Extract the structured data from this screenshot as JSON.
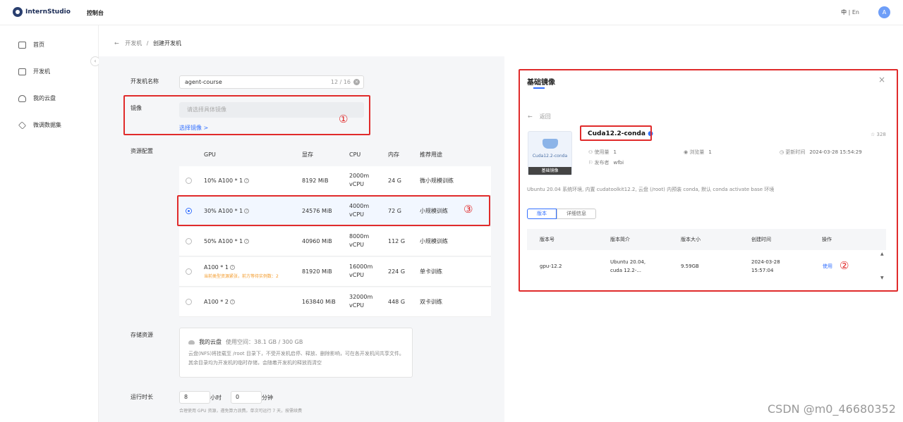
{
  "header": {
    "logo_text": "InternStudio",
    "console_label": "控制台",
    "lang_zh": "中",
    "lang_sep": "|",
    "lang_en": "En",
    "avatar_letter": "A"
  },
  "sidebar": {
    "items": [
      {
        "label": "首页",
        "icon": "home-icon"
      },
      {
        "label": "开发机",
        "icon": "terminal-icon"
      },
      {
        "label": "我的云盘",
        "icon": "cloud-icon"
      },
      {
        "label": "微调数据集",
        "icon": "dataset-icon"
      }
    ]
  },
  "breadcrumb": {
    "parent": "开发机",
    "sep": "/",
    "current": "创建开发机"
  },
  "form": {
    "name_label": "开发机名称",
    "name_value": "agent-course",
    "name_count": "12 / 16",
    "image_label": "镜像",
    "image_placeholder": "请选择具体镜像",
    "select_image_link": "选择镜像 >",
    "resource_label": "资源配置",
    "storage_label": "存储资源",
    "runtime_label": "运行时长"
  },
  "resource_table": {
    "headers": [
      "GPU",
      "显存",
      "CPU",
      "内存",
      "推荐用途"
    ],
    "rows": [
      {
        "gpu": "10% A100 * 1",
        "mem": "8192 MiB",
        "cpu1": "2000m",
        "cpu2": "vCPU",
        "ram": "24 G",
        "usage": "微小规模训练",
        "warn": ""
      },
      {
        "gpu": "30% A100 * 1",
        "mem": "24576 MiB",
        "cpu1": "4000m",
        "cpu2": "vCPU",
        "ram": "72 G",
        "usage": "小规模训练",
        "warn": ""
      },
      {
        "gpu": "50% A100 * 1",
        "mem": "40960 MiB",
        "cpu1": "8000m",
        "cpu2": "vCPU",
        "ram": "112 G",
        "usage": "小规模训练",
        "warn": ""
      },
      {
        "gpu": "A100 * 1",
        "mem": "81920 MiB",
        "cpu1": "16000m",
        "cpu2": "vCPU",
        "ram": "224 G",
        "usage": "单卡训练",
        "warn": "当前类型资源紧张，前方等待实例数：2"
      },
      {
        "gpu": "A100 * 2",
        "mem": "163840 MiB",
        "cpu1": "32000m",
        "cpu2": "vCPU",
        "ram": "448 G",
        "usage": "双卡训练",
        "warn": ""
      }
    ],
    "selected_index": 1
  },
  "storage": {
    "title": "我的云盘",
    "usage": "使用空间：38.1 GB / 300 GB",
    "desc": "云盘(NFS)将挂载至 /root 目录下，不受开发机启停、释放、删除影响，可在各开发机间共享文件。其余目录均为开发机的临时存储，会随着开发机的释放而清空"
  },
  "runtime": {
    "hours": "8",
    "hours_unit": "小时",
    "minutes": "0",
    "minutes_unit": "分钟",
    "note": "合理使用 GPU 资源，遵免算力浪费。单次可运行 7 天，按需续费"
  },
  "annotations": {
    "one": "①",
    "two": "②",
    "three": "③"
  },
  "image_panel": {
    "title": "基础镜像",
    "close": "×",
    "back_arrow": "←",
    "back": "返回",
    "card_caption": "Cuda12.2-conda",
    "card_badge": "基础镜像",
    "name": "Cuda12.2-conda",
    "star_count": "328",
    "usage_label": "使用量",
    "usage_value": "1",
    "views_label": "浏览量",
    "views_value": "1",
    "updated_label": "更新时间",
    "updated_value": "2024-03-28 15:54:29",
    "publisher_label": "发布者",
    "publisher_value": "wfbi",
    "description": "Ubuntu 20.04 系统环境, 内置 cudatoolkit12.2, 云盘 (/root) 内预装 conda, 默认 conda activate base 环境",
    "tabs": [
      "版本",
      "详细信息"
    ],
    "table_headers": [
      "版本号",
      "版本简介",
      "版本大小",
      "创建时间",
      "操作"
    ],
    "row": {
      "version": "gpu-12.2",
      "intro1": "Ubuntu 20.04,",
      "intro2": "cuda 12.2-...",
      "size": "9.59GB",
      "created1": "2024-03-28",
      "created2": "15:57:04",
      "action": "使用"
    }
  },
  "watermark": "CSDN @m0_46680352",
  "colors": {
    "accent": "#3370ff",
    "annotation_red": "#e02b2b",
    "warn": "#f39b2b"
  }
}
